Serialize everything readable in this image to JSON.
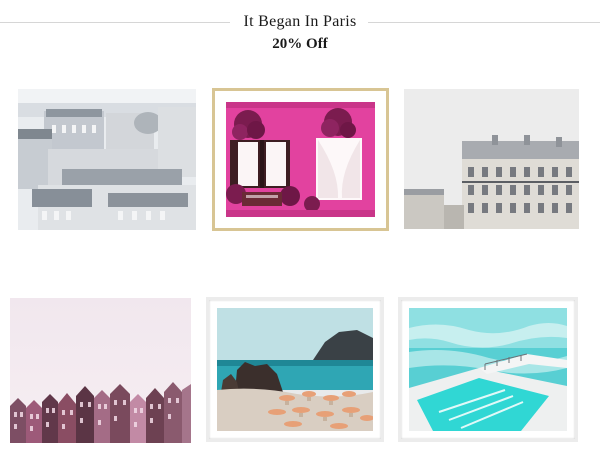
{
  "header": {
    "title": "It Began  In Paris",
    "subtitle": "20% Off"
  },
  "products": [
    {
      "subject": "paris-rooftops",
      "frame": "none"
    },
    {
      "subject": "pink-facade-windows",
      "frame": "gold"
    },
    {
      "subject": "haussmann-building",
      "frame": "none"
    },
    {
      "subject": "amsterdam-canal-houses",
      "frame": "none"
    },
    {
      "subject": "rocky-beach-umbrellas",
      "frame": "white"
    },
    {
      "subject": "ocean-pool",
      "frame": "white"
    }
  ],
  "colors": {
    "gold_frame": "#d8c594",
    "pink_wall": "#e2429f",
    "sea": "#3fc4c9",
    "pool": "#30d7d4"
  }
}
